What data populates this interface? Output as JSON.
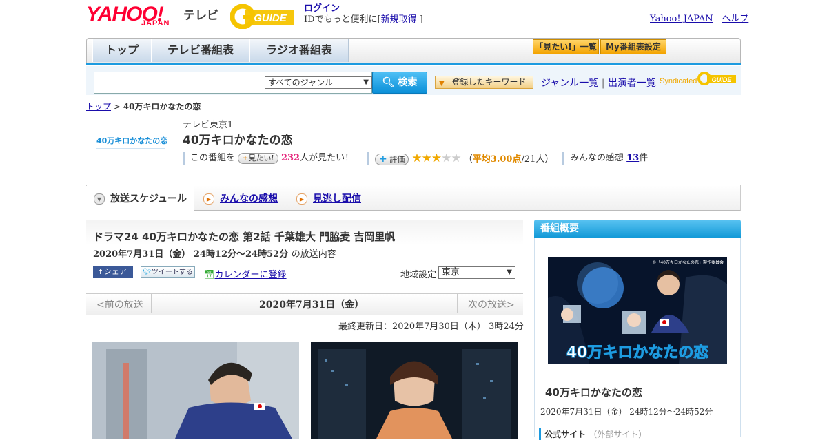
{
  "header": {
    "logo_yahoo": "YAHOO!",
    "logo_japan": "JAPAN",
    "logo_tv": "テレビ",
    "logo_gguide": "GUIDE",
    "login_label": "ログイン",
    "login_note_prefix": "IDでもっと便利に[",
    "signup_label": "新規取得",
    "login_note_suffix": "]",
    "yahoo_japan_link": "Yahoo! JAPAN",
    "separator": " - ",
    "help_link": "ヘルプ"
  },
  "nav": {
    "tabs": [
      "トップ",
      "テレビ番組表",
      "ラジオ番組表"
    ],
    "mitai_list": "「見たい!」一覧",
    "my_listing": "My番組表設定"
  },
  "search": {
    "genre_selected": "すべてのジャンル",
    "button": "検索",
    "keyword_button": "登録したキーワード",
    "genre_list": "ジャンル一覧",
    "divider": "|",
    "performer_list": "出演者一覧",
    "syndicated": "Syndicated"
  },
  "breadcrumb": {
    "home": "トップ",
    "separator": ">",
    "current": "40万キロかなたの恋"
  },
  "program": {
    "thumb_text": "40万キロかなたの恋",
    "station": "テレビ東京1",
    "title": "40万キロかなたの恋",
    "mitai_prefix": "この番組を",
    "mitai_button": "見たい!",
    "mitai_count": "232",
    "mitai_suffix": "人が見たい！",
    "rate_button": "評価",
    "rating_stars": 3,
    "rating_max": 5,
    "rating_open": "（",
    "avg_label": "平均3.00点",
    "rating_count": "/21人）",
    "impressions_label": "みんなの感想",
    "impressions_count": "13",
    "impressions_unit": "件"
  },
  "subtabs": {
    "schedule": "放送スケジュール",
    "reviews": "みんなの感想",
    "streaming": "見逃し配信"
  },
  "episode": {
    "title": "ドラマ24 40万キロかなたの恋 第2話 千葉雄大 門脇麦 吉岡里帆",
    "datetime": "2020年7月31日（金）  24時12分～24時52分",
    "datetime_suffix": "の放送内容",
    "facebook_share": "シェア",
    "tweet": "ツイートする",
    "calendar": "カレンダーに登録",
    "region_label": "地域設定",
    "region_selected": "東京",
    "prev": "<前の放送",
    "day": "2020年7月31日（金）",
    "next": "次の放送>",
    "updated": "最終更新日：2020年7月30日（木） 3時24分"
  },
  "sidebar": {
    "header": "番組概要",
    "image_caption": "40万キロかなたの恋",
    "copyright": "©「40万キロかなたの恋」製作委員会",
    "title": "40万キロかなたの恋",
    "datetime": "2020年7月31日（金）  24時12分～24時52分",
    "official_site": "公式サイト",
    "external": "（外部サイト）"
  },
  "colors": {
    "accent": "#1d9be0",
    "brand_red": "#ff0033",
    "gguide_yellow": "#f5c400",
    "pink": "#e5257b",
    "star": "#f0a800"
  }
}
